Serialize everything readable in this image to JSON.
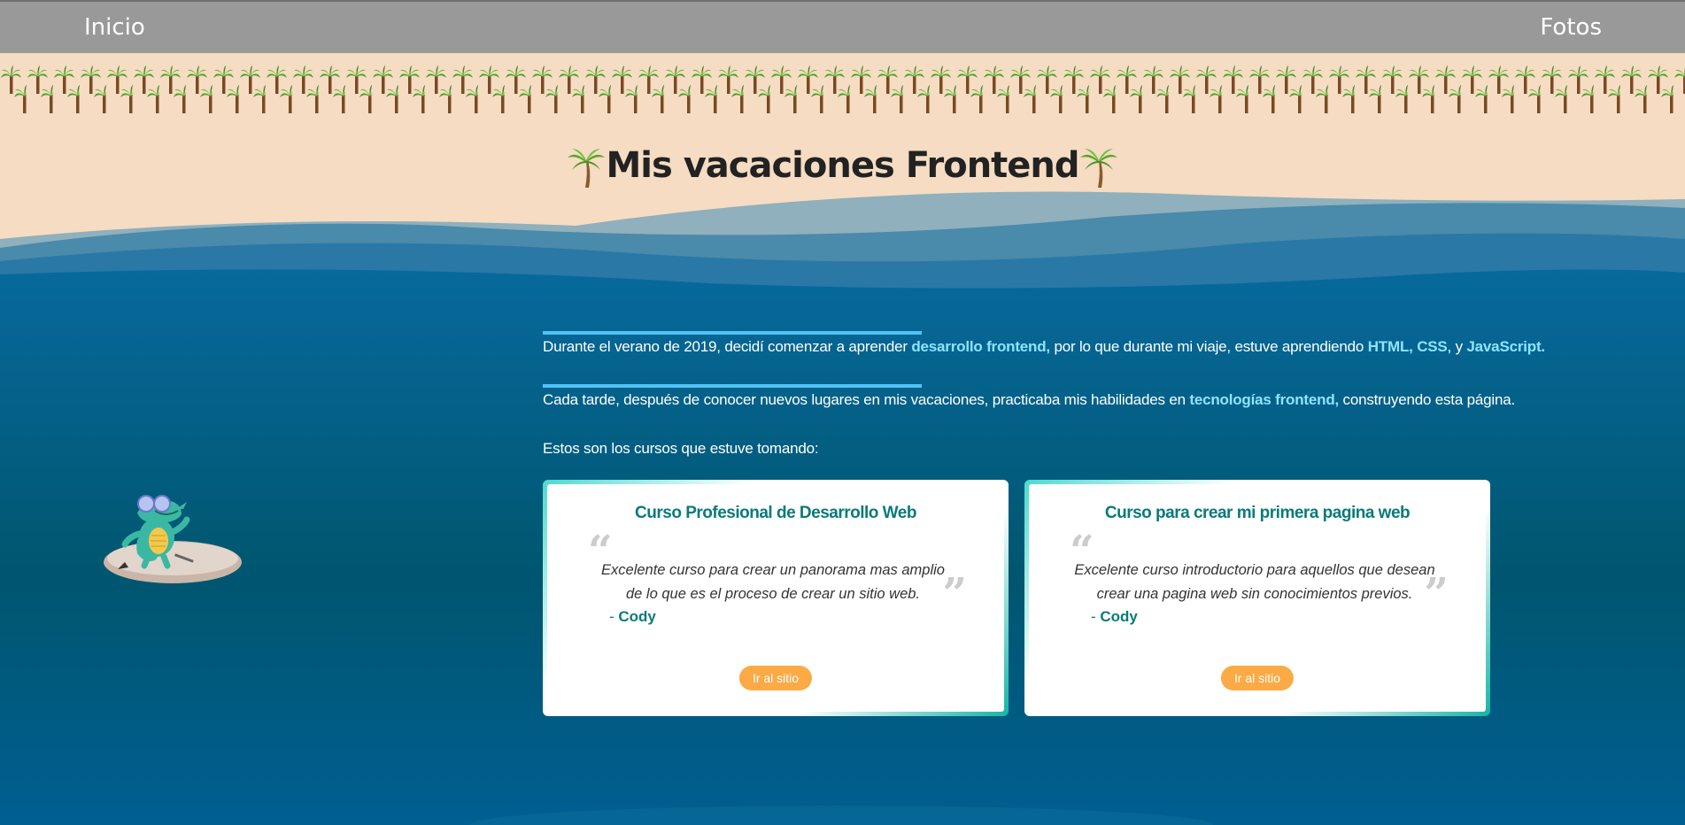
{
  "nav": {
    "home_label": "Inicio",
    "photos_label": "Fotos"
  },
  "header": {
    "title": "Mis vacaciones Frontend"
  },
  "intro": {
    "p1_before": "Durante el verano de 2019, decidí comenzar a aprender ",
    "p1_hl1": "desarrollo frontend,",
    "p1_mid": " por lo que durante mi viaje, estuve aprendiendo ",
    "p1_hl2": "HTML",
    "p1_sep1": ", ",
    "p1_hl3": "CSS",
    "p1_sep2": ", y ",
    "p1_hl4": "JavaScript.",
    "p2_before": "Cada tarde, después de conocer nuevos lugares en mis vacaciones, practicaba mis habilidades en ",
    "p2_hl": "tecnologías frontend,",
    "p2_after": " construyendo esta página.",
    "p3": "Estos son los cursos que estuve tomando:"
  },
  "courses": [
    {
      "title": "Curso Profesional de Desarrollo Web",
      "quote_open": "“",
      "quote_close": "”",
      "quote": "Excelente curso para crear un panorama mas amplio de lo que es el proceso de crear un sitio web.",
      "author_dash": "- ",
      "author": "Cody",
      "button_label": "Ir al sitio"
    },
    {
      "title": "Curso para crear mi primera pagina web",
      "quote_open": "“",
      "quote_close": "”",
      "quote": "Excelente curso introductorio para aquellos que desean crear una pagina web sin conocimientos previos.",
      "author_dash": "- ",
      "author": "Cody",
      "button_label": "Ir al sitio"
    }
  ],
  "colors": {
    "nav_bg": "#999999",
    "sand": "#f5dcc2",
    "ocean": "#005a78",
    "highlight": "#8fe3ff",
    "divider": "#4fc3f7",
    "card_title": "#0a7a7a",
    "button": "#fbaa45"
  },
  "icons": {
    "title_decoration": "palm-tree-icon",
    "mascot": "crocodile-surfer-illustration"
  }
}
